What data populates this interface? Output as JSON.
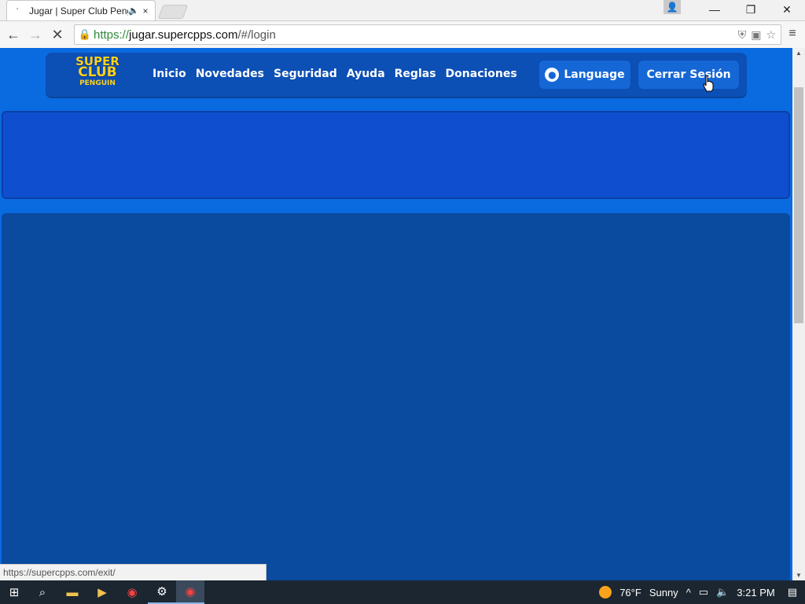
{
  "browser": {
    "tab_title": "Jugar | Super Club Peng",
    "tab_close": "×",
    "audio_icon": "speaker-icon",
    "url_secure": "https://",
    "url_host": "jugar.supercpps.com",
    "url_path": "/#/login",
    "status_url": "https://supercpps.com/exit/",
    "window_controls": [
      "—",
      "❐",
      "✕"
    ]
  },
  "site": {
    "logo": {
      "line1": "SUPER",
      "line2": "CLUB",
      "line3": "PENGUIN"
    },
    "nav": [
      "Inicio",
      "Novedades",
      "Seguridad",
      "Ayuda",
      "Reglas",
      "Donaciones"
    ],
    "language_label": "Language",
    "logout_label": "Cerrar Sesión"
  },
  "taskbar": {
    "weather_temp": "76°F",
    "weather_text": "Sunny",
    "time": "3:21 PM"
  },
  "colors": {
    "page_bg": "#0a6ae0",
    "header_bg": "#0c4fb5",
    "panel_top": "#0f4fcf",
    "panel_main": "#0a4a9f",
    "logo_yellow": "#ffd21a"
  }
}
